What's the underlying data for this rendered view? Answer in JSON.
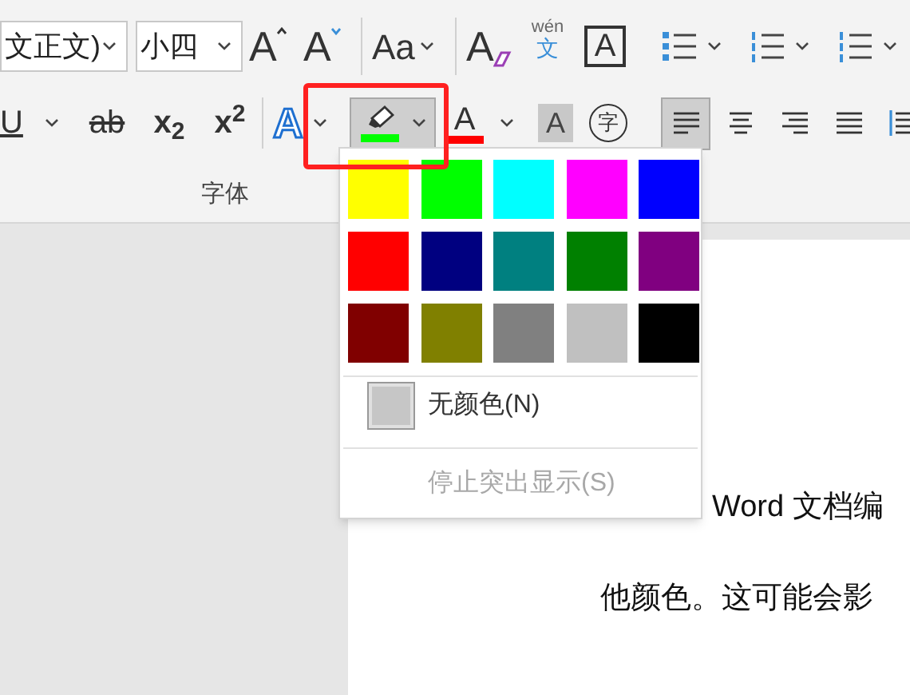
{
  "ribbon": {
    "row_1": [
      {
        "kind": "combo",
        "value": "文正文)"
      },
      {
        "kind": "combo",
        "value": "小四"
      },
      {
        "kind": "grow",
        "glyph": "A"
      },
      {
        "kind": "shrink",
        "glyph": "A"
      },
      {
        "kind": "divider"
      },
      {
        "kind": "case",
        "glyph": "Aa"
      },
      {
        "kind": "divider"
      },
      {
        "kind": "clear",
        "glyph": "A"
      },
      {
        "kind": "phonetic",
        "glyph": "wén",
        "sub_glyph": "文"
      },
      {
        "kind": "boxed",
        "glyph": "A"
      }
    ],
    "row_2": [
      {
        "kind": "underline",
        "glyph": "U"
      },
      {
        "kind": "strike",
        "glyph": "ab"
      },
      {
        "kind": "script",
        "glyph": "x$_{2}$"
      },
      {
        "kind": "script",
        "glyph": "x$^{2}$"
      },
      {
        "kind": "divider"
      },
      {
        "kind": "effects",
        "glyph": "A"
      },
      {
        "kind": "highlight",
        "selected": true,
        "color": "#00ff00"
      },
      {
        "kind": "fontcolor",
        "glyph": "A",
        "color": "#ff0000"
      },
      {
        "kind": "shading",
        "glyph": "A"
      },
      {
        "kind": "enclose",
        "glyph": "字"
      }
    ],
    "group_label": "字体",
    "lists": [
      {
        "kind": "bullets"
      },
      {
        "kind": "numbering"
      },
      {
        "kind": "multilevel"
      }
    ],
    "alignment": [
      {
        "kind": "left",
        "selected": true
      },
      {
        "kind": "center",
        "selected": false
      },
      {
        "kind": "right",
        "selected": false
      },
      {
        "kind": "justify",
        "selected": false
      },
      {
        "kind": "indent",
        "selected": false
      }
    ]
  },
  "highlight_menu": {
    "colors": [
      {
        "color": "#ffff00"
      },
      {
        "color": "#00ff00"
      },
      {
        "color": "#00ffff"
      },
      {
        "color": "#ff00ff"
      },
      {
        "color": "#0000ff"
      },
      {
        "color": "#ff0000"
      },
      {
        "color": "#000080"
      },
      {
        "color": "#008080"
      },
      {
        "color": "#008000"
      },
      {
        "color": "#800080"
      },
      {
        "color": "#800000"
      },
      {
        "color": "#808000"
      },
      {
        "color": "#808080"
      },
      {
        "color": "#c0c0c0"
      },
      {
        "color": "#000000"
      }
    ],
    "items": [
      {
        "kind": "no_color",
        "label": "无颜色(N)",
        "disabled": false
      },
      {
        "kind": "stop",
        "label": "停止突出显示(S)",
        "disabled": true
      }
    ]
  },
  "document": {
    "lines": [
      "Word 文档编",
      "他颜色。这可能会影"
    ]
  }
}
